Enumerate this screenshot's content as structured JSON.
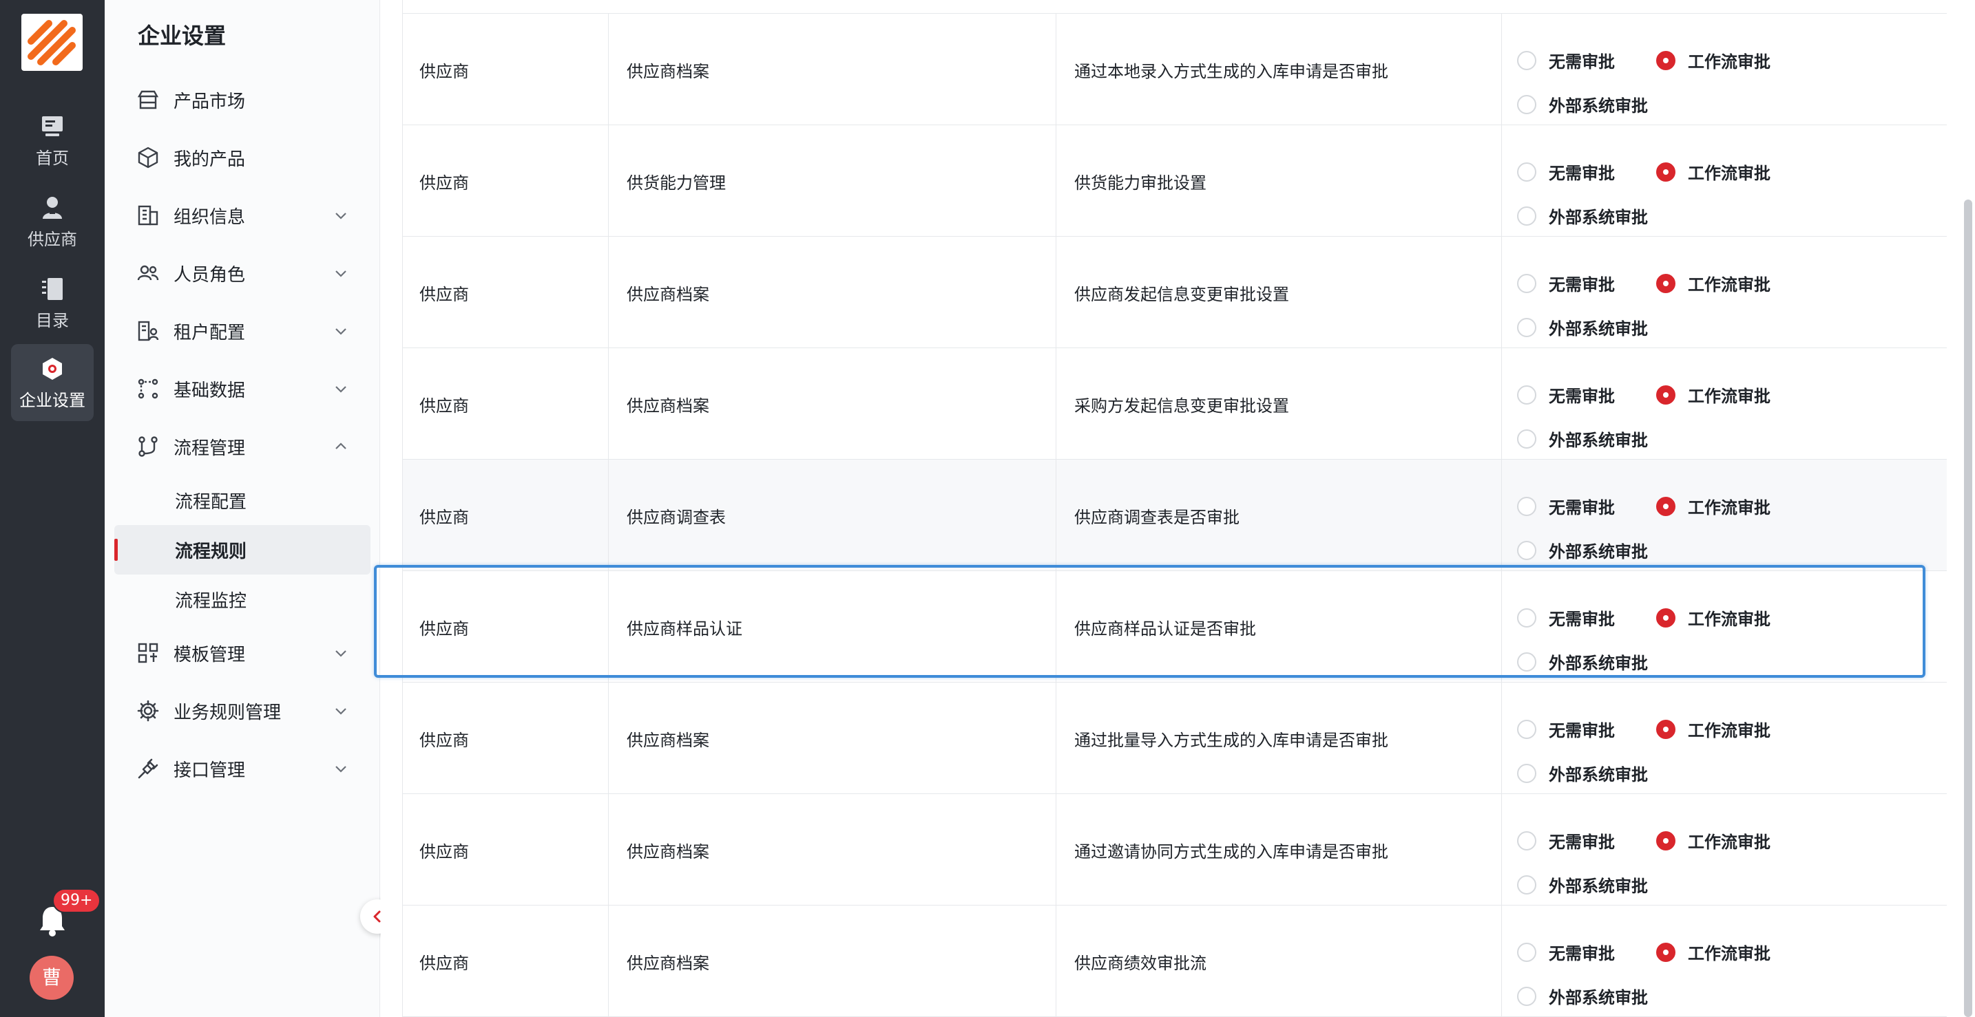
{
  "app": {
    "logo_icon": "brand-logo-icon"
  },
  "rail": {
    "items": [
      {
        "label": "首页",
        "icon": "monitor-icon"
      },
      {
        "label": "供应商",
        "icon": "person-icon"
      },
      {
        "label": "目录",
        "icon": "book-icon"
      },
      {
        "label": "企业设置",
        "icon": "hexagon-settings-icon",
        "active": true
      }
    ],
    "notifications": {
      "badge": "99+",
      "icon": "bell-icon"
    },
    "avatar": {
      "initial": "曹",
      "color": "#ea6b66"
    }
  },
  "sidebar": {
    "title": "企业设置",
    "menu": [
      {
        "label": "产品市场",
        "icon": "store-icon"
      },
      {
        "label": "我的产品",
        "icon": "cube-icon"
      },
      {
        "label": "组织信息",
        "icon": "building-icon",
        "expandable": true
      },
      {
        "label": "人员角色",
        "icon": "users-icon",
        "expandable": true
      },
      {
        "label": "租户配置",
        "icon": "tenant-icon",
        "expandable": true
      },
      {
        "label": "基础数据",
        "icon": "data-icon",
        "expandable": true
      },
      {
        "label": "流程管理",
        "icon": "flow-icon",
        "expandable": true,
        "expanded": true,
        "children": [
          {
            "label": "流程配置"
          },
          {
            "label": "流程规则",
            "active": true
          },
          {
            "label": "流程监控"
          }
        ]
      },
      {
        "label": "模板管理",
        "icon": "template-icon",
        "expandable": true
      },
      {
        "label": "业务规则管理",
        "icon": "gear-icon",
        "expandable": true
      },
      {
        "label": "接口管理",
        "icon": "plug-icon",
        "expandable": true
      }
    ],
    "collapse_icon": "chevron-left-icon"
  },
  "table": {
    "options": [
      "无需审批",
      "工作流审批",
      "外部系统审批"
    ],
    "rows": [
      {
        "module": "供应商",
        "business": "供应商档案",
        "rule": "通过本地录入方式生成的入库申请是否审批",
        "selected": "工作流审批"
      },
      {
        "module": "供应商",
        "business": "供货能力管理",
        "rule": "供货能力审批设置",
        "selected": "工作流审批"
      },
      {
        "module": "供应商",
        "business": "供应商档案",
        "rule": "供应商发起信息变更审批设置",
        "selected": "工作流审批"
      },
      {
        "module": "供应商",
        "business": "供应商档案",
        "rule": "采购方发起信息变更审批设置",
        "selected": "工作流审批"
      },
      {
        "module": "供应商",
        "business": "供应商调查表",
        "rule": "供应商调查表是否审批",
        "selected": "工作流审批"
      },
      {
        "module": "供应商",
        "business": "供应商样品认证",
        "rule": "供应商样品认证是否审批",
        "selected": "工作流审批"
      },
      {
        "module": "供应商",
        "business": "供应商档案",
        "rule": "通过批量导入方式生成的入库申请是否审批",
        "selected": "工作流审批"
      },
      {
        "module": "供应商",
        "business": "供应商档案",
        "rule": "通过邀请协同方式生成的入库申请是否审批",
        "selected": "工作流审批"
      },
      {
        "module": "供应商",
        "business": "供应商档案",
        "rule": "供应商绩效审批流",
        "selected": "工作流审批"
      }
    ]
  },
  "colors": {
    "accent": "#d9262c",
    "rail_bg": "#2b2f36",
    "highlight": "#3f8cd8"
  }
}
